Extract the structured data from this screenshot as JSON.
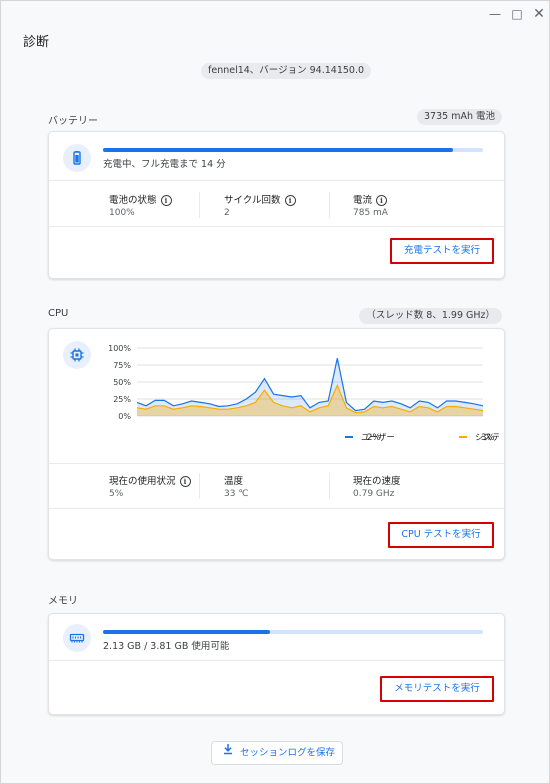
{
  "app": {
    "title": "診断",
    "version_pill": "fennel14、バージョン 94.14150.0"
  },
  "battery": {
    "label": "バッテリー",
    "capacity_pill": "3735 mAh 電池",
    "progress": 0.92,
    "status_text": "充電中、フル充電まで 14 分",
    "stats": [
      {
        "label": "電池の状態",
        "value": "100%"
      },
      {
        "label": "サイクル回数",
        "value": "2"
      },
      {
        "label": "電流",
        "value": "785 mA"
      }
    ],
    "button_label": "充電テストを実行",
    "icon": "battery-icon"
  },
  "cpu": {
    "label": "CPU",
    "info_pill": "（スレッド数 8、1.99 GHz）",
    "stats": [
      {
        "label": "現在の使用状況",
        "value": "5%"
      },
      {
        "label": "温度",
        "value": "33 ℃"
      },
      {
        "label": "現在の速度",
        "value": "0.79 GHz"
      }
    ],
    "button_label": "CPU テストを実行",
    "icon": "cpu-chip-icon"
  },
  "memory": {
    "label": "メモリ",
    "progress": 0.44,
    "status_text": "2.13 GB / 3.81 GB 使用可能",
    "button_label": "メモリテストを実行",
    "icon": "memory-icon"
  },
  "footer": {
    "save_label": "セッションログを保存",
    "icon": "download-icon"
  },
  "colors": {
    "accent": "#1a73e8",
    "system": "#f9ab00",
    "highlight": "#d50000"
  },
  "chart_data": {
    "type": "area",
    "ylim": [
      0,
      100
    ],
    "yticks": [
      "100%",
      "75%",
      "50%",
      "25%",
      "0%"
    ],
    "grid": true,
    "legend_position": "bottom-right",
    "series": [
      {
        "name": "ユーザー",
        "legend_value": "2%",
        "color": "#1a73e8",
        "values": [
          20,
          15,
          23,
          23,
          15,
          18,
          22,
          20,
          18,
          14,
          15,
          18,
          25,
          35,
          55,
          32,
          30,
          28,
          30,
          12,
          20,
          22,
          85,
          20,
          8,
          10,
          22,
          20,
          22,
          18,
          12,
          22,
          20,
          12,
          22,
          22,
          20,
          18,
          15
        ]
      },
      {
        "name": "システム",
        "legend_value": "3%",
        "color": "#f9ab00",
        "values": [
          12,
          10,
          15,
          15,
          10,
          12,
          15,
          14,
          12,
          10,
          10,
          12,
          15,
          20,
          38,
          20,
          15,
          12,
          15,
          6,
          12,
          15,
          45,
          12,
          5,
          6,
          14,
          12,
          14,
          10,
          6,
          14,
          12,
          6,
          14,
          14,
          12,
          10,
          8
        ]
      }
    ]
  }
}
